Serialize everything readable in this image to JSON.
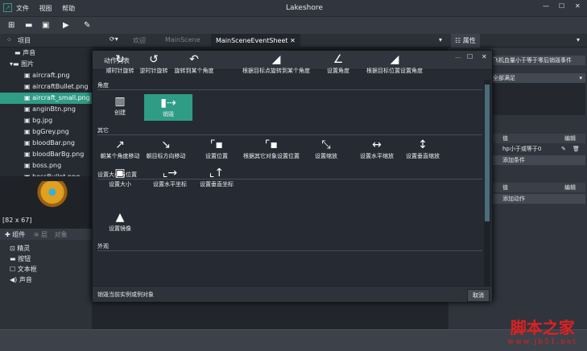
{
  "app": {
    "title": "Lakeshore",
    "menu": [
      "文件",
      "视图",
      "帮助"
    ]
  },
  "tabs": {
    "project": "项目",
    "welcome": "欢迎",
    "main_scene": "MainScene",
    "event_sheet": "MainSceneEventSheet",
    "properties": "属性"
  },
  "tree": {
    "items": [
      {
        "label": "声音",
        "type": "folder"
      },
      {
        "label": "图片",
        "type": "folder-open"
      },
      {
        "label": "aircraft.png"
      },
      {
        "label": "aircraftBullet.png"
      },
      {
        "label": "aircraft_small.png",
        "selected": true
      },
      {
        "label": "anginBtn.png"
      },
      {
        "label": "bg.jpg"
      },
      {
        "label": "bgGrey.png"
      },
      {
        "label": "bloodBar.png"
      },
      {
        "label": "bloodBarBg.png"
      },
      {
        "label": "boss.png"
      },
      {
        "label": "bossBullet.png"
      }
    ]
  },
  "preview": {
    "size": "[82 x 67]"
  },
  "components": {
    "tabs": [
      "组件",
      "层",
      "对象"
    ],
    "items": [
      "精灵",
      "按钮",
      "文本框",
      "声音"
    ]
  },
  "modal": {
    "title": "动作列表",
    "cancel": "取消",
    "description": "销毁当前实例或例对象",
    "sections": [
      {
        "title": "角度",
        "items": [
          "顺时针旋转",
          "逆时针旋转",
          "旋转到某个角度",
          "根据目标点旋转到某个角度",
          "设置角度",
          "根据目标位置设置角度"
        ]
      },
      {
        "title": "其它",
        "items": [
          "创建",
          "销毁"
        ]
      },
      {
        "title": "设置大小与位置",
        "items": [
          "朝某个角度移动",
          "朝目标方向移动",
          "设置位置",
          "根据其它对象设置位置",
          "设置缩放",
          "设置水平缩放",
          "设置垂直缩放",
          "设置大小",
          "设置水平坐标",
          "设置垂直坐标"
        ]
      },
      {
        "title": "外观",
        "items": [
          "设置镜像"
        ]
      }
    ]
  },
  "properties": {
    "event_name": "飞机血量小于等于零后销毁事件",
    "condition_mode": "全部满足",
    "cond_header": "值",
    "edit_header": "编辑",
    "condition": "hp小于或等于0",
    "add_condition": "添加条件",
    "action_header": "值",
    "action_edit": "编辑",
    "add_action": "添加动作"
  },
  "watermark": {
    "text": "脚本之家",
    "url": "www.jb51.net"
  }
}
